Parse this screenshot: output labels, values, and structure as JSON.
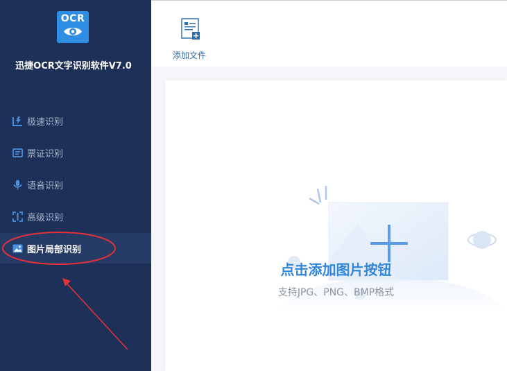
{
  "app": {
    "logo_text": "OCR",
    "title": "迅捷OCR文字识别软件V7.0"
  },
  "sidebar": {
    "items": [
      {
        "label": "极速识别",
        "icon": "fast-scan-icon"
      },
      {
        "label": "票证识别",
        "icon": "ticket-icon"
      },
      {
        "label": "语音识别",
        "icon": "microphone-icon"
      },
      {
        "label": "高级识别",
        "icon": "scan-frame-icon"
      },
      {
        "label": "图片局部识别",
        "icon": "image-icon",
        "active": true
      }
    ]
  },
  "toolbar": {
    "add_file_label": "添加文件"
  },
  "drop_area": {
    "title": "点击添加图片按钮",
    "subtitle": "支持JPG、PNG、BMP格式"
  },
  "colors": {
    "sidebar_bg": "#1d3057",
    "sidebar_active": "#253b66",
    "accent": "#2f86dc",
    "annotation": "#e5303a"
  }
}
